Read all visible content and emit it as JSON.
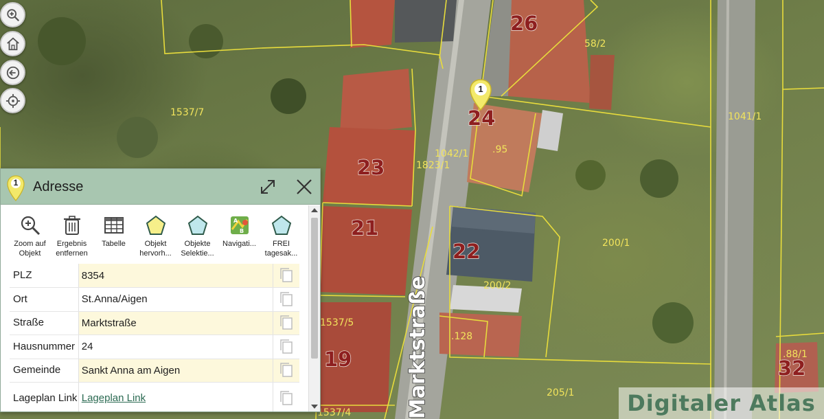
{
  "map": {
    "parcel_labels": [
      "1537/7",
      "58/2",
      "1041/1",
      "1042/1",
      "1823/1",
      ".95",
      "200/1",
      "200/2",
      "1537/5",
      ".128",
      "205/1",
      ".88/1",
      "1537/4"
    ],
    "house_numbers": [
      "26",
      "24",
      "23",
      "21",
      "22",
      "19",
      "32"
    ],
    "street_name": "Marktstraße",
    "marker_label": "1",
    "watermark": "Digitaler Atlas"
  },
  "nav_buttons": [
    {
      "name": "zoom-in",
      "icon": "magnifier-plus-icon"
    },
    {
      "name": "home",
      "icon": "house-icon"
    },
    {
      "name": "back",
      "icon": "arrow-left-icon"
    },
    {
      "name": "locate",
      "icon": "crosshair-icon"
    }
  ],
  "panel": {
    "pin_label": "1",
    "title": "Adresse",
    "expand_icon": "expand-icon",
    "close_icon": "close-icon",
    "toolbar": [
      {
        "label_1": "Zoom auf",
        "label_2": "Objekt",
        "icon": "zoom-object-icon"
      },
      {
        "label_1": "Ergebnis",
        "label_2": "entfernen",
        "icon": "trash-icon"
      },
      {
        "label_1": "Tabelle",
        "label_2": "",
        "icon": "table-icon"
      },
      {
        "label_1": "Objekt",
        "label_2": "hervorh...",
        "icon": "highlight-pentagon-icon"
      },
      {
        "label_1": "Objekte",
        "label_2": "Selektie...",
        "icon": "select-pentagon-icon"
      },
      {
        "label_1": "Navigati...",
        "label_2": "",
        "icon": "navigation-icon"
      },
      {
        "label_1": "FREI",
        "label_2": "tagesak...",
        "icon": "pentagon-icon"
      }
    ],
    "rows": [
      {
        "key": "PLZ",
        "value": "8354"
      },
      {
        "key": "Ort",
        "value": "St.Anna/Aigen"
      },
      {
        "key": "Straße",
        "value": "Marktstraße"
      },
      {
        "key": "Hausnummer",
        "value": "24"
      },
      {
        "key": "Gemeinde",
        "value": "Sankt Anna am Aigen"
      },
      {
        "key": "Lageplan Link",
        "value": "Lageplan Link"
      }
    ]
  },
  "colors": {
    "panel_header": "#a8c6b0",
    "row_highlight": "#fdf8dc",
    "parcel_line": "#e8dc3c",
    "link": "#2b6a52",
    "watermark_text": "#4d7a5e"
  }
}
